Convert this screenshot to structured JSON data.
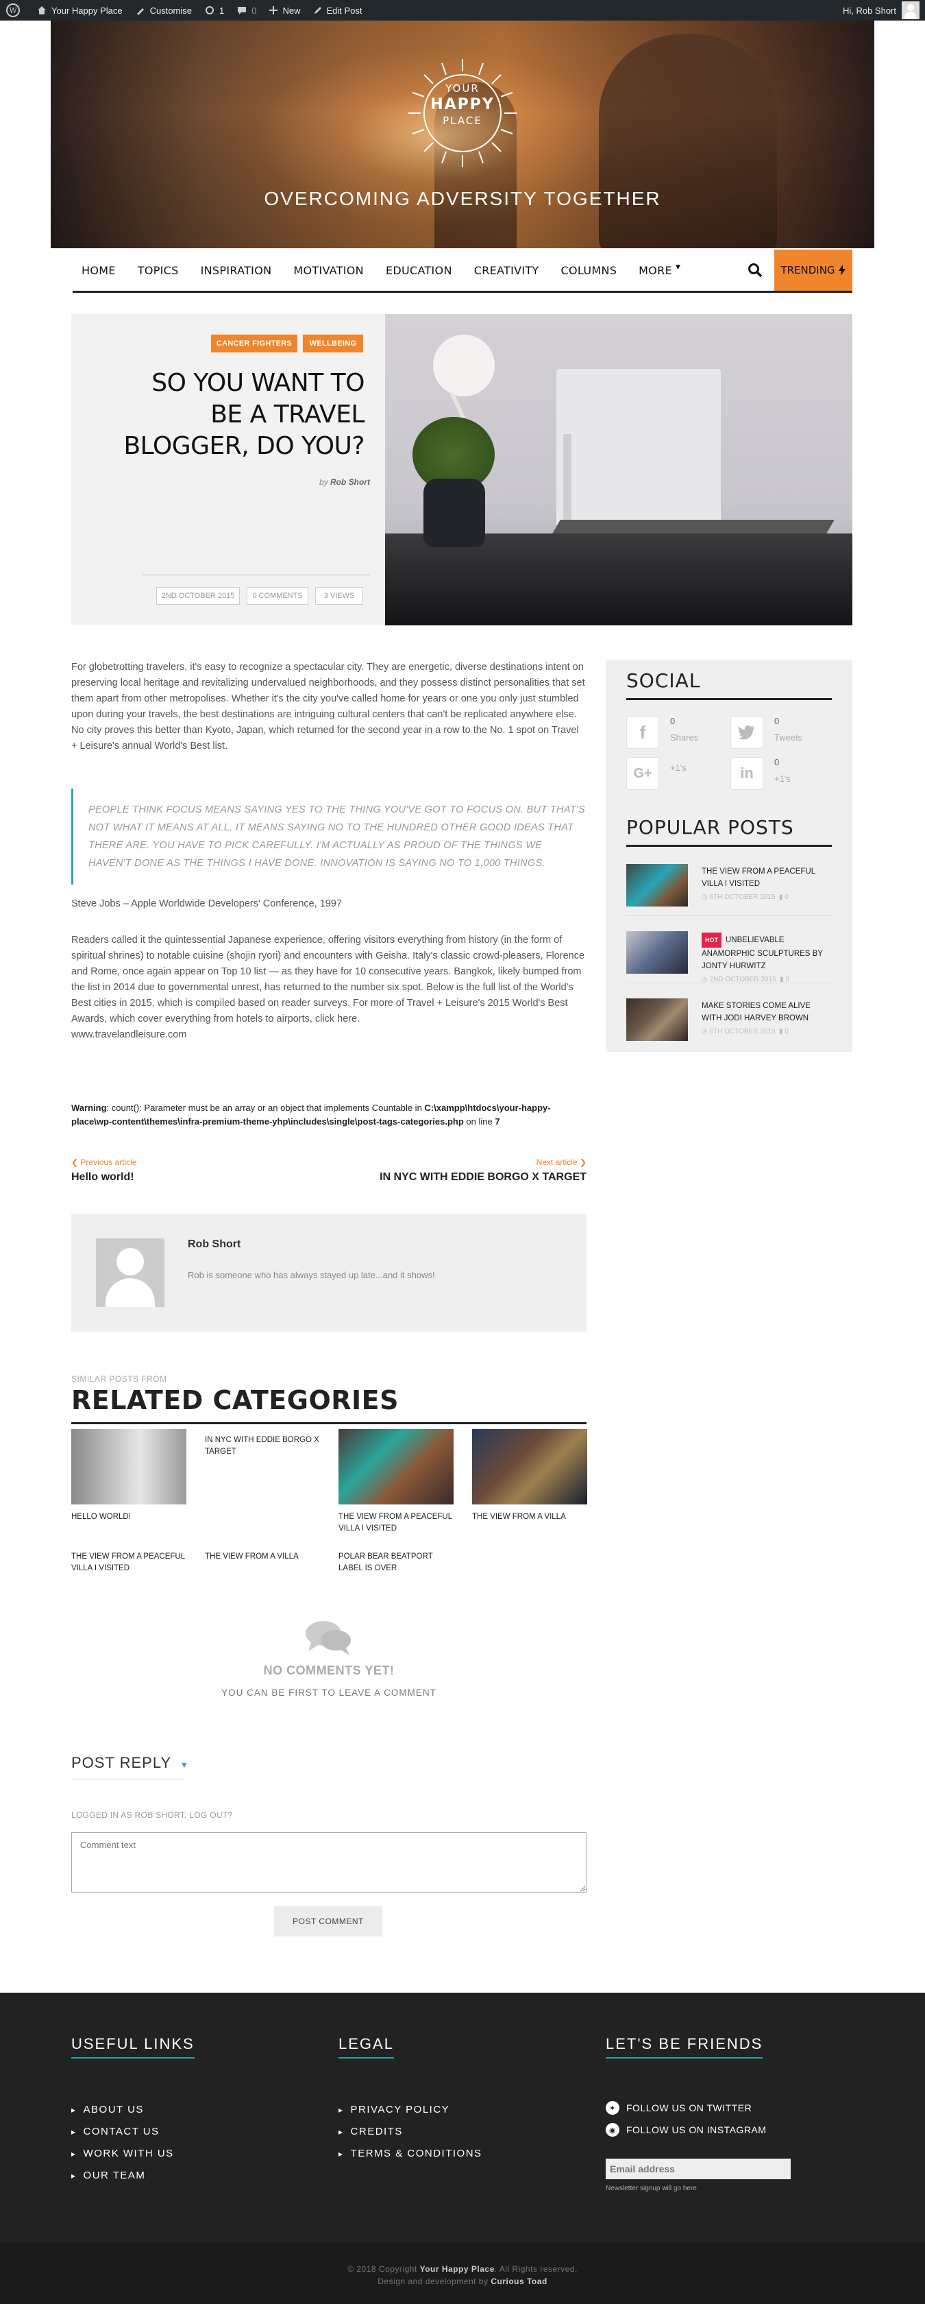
{
  "admin_bar": {
    "site": "Your Happy Place",
    "customise": "Customise",
    "updates": "1",
    "comments": "0",
    "new": "New",
    "edit": "Edit Post",
    "greeting": "Hi, Rob Short"
  },
  "header": {
    "logo_line1": "YOUR",
    "logo_line2": "HAPPY",
    "logo_line3": "PLACE",
    "tagline": "OVERCOMING ADVERSITY TOGETHER"
  },
  "nav": {
    "items": [
      "HOME",
      "TOPICS",
      "INSPIRATION",
      "MOTIVATION",
      "EDUCATION",
      "CREATIVITY",
      "COLUMNS",
      "MORE"
    ],
    "trending": "TRENDING"
  },
  "post": {
    "tags": [
      "CANCER FIGHTERS",
      "WELLBEING"
    ],
    "title": "SO YOU WANT TO BE A TRAVEL BLOGGER, DO YOU?",
    "by": "by",
    "author": "Rob Short",
    "date": "2ND OCTOBER 2015",
    "comments": "0 COMMENTS",
    "views": "3 VIEWS",
    "paragraph1": "For globetrotting travelers, it's easy to recognize a spectacular city. They are energetic, diverse destinations intent on preserving local heritage and revitalizing undervalued neighborhoods, and they possess distinct personalities that set them apart from other metropolises. Whether it's the city you've called home for years or one you only just stumbled upon during your travels, the best destinations are intriguing cultural centers that can't be replicated anywhere else. No city proves this better than Kyoto, Japan, which returned for the second year in a row to the No. 1 spot on Travel + Leisure's annual World's Best list.",
    "quote": "PEOPLE THINK FOCUS MEANS SAYING YES TO THE THING YOU'VE GOT TO FOCUS ON. BUT THAT'S NOT WHAT IT MEANS AT ALL. IT MEANS SAYING NO TO THE HUNDRED OTHER GOOD IDEAS THAT THERE ARE. YOU HAVE TO PICK CAREFULLY. I'M ACTUALLY AS PROUD OF THE THINGS WE HAVEN'T DONE AS THE THINGS I HAVE DONE. INNOVATION IS SAYING NO TO 1,000 THINGS.",
    "quote_source": "Steve Jobs – Apple Worldwide Developers' Conference, 1997",
    "paragraph2": "Readers called it the quintessential Japanese experience, offering visitors everything from history (in the form of spiritual shrines) to notable cuisine (shojin ryori) and encounters with Geisha. Italy's classic crowd-pleasers, Florence and Rome, once again appear on Top 10 list — as they have for 10 consecutive years. Bangkok, likely bumped from the list in 2014 due to governmental unrest, has returned to the number six spot. Below is the full list of the World's Best cities in 2015, which is compiled based on reader surveys. For more of Travel + Leisure's 2015 World's Best Awards, which cover everything from hotels to airports, click here.",
    "source_link": "www.travelandleisure.com"
  },
  "warning": {
    "label": "Warning",
    "text1": ": count(): Parameter must be an array or an object that implements Countable in ",
    "path": "C:\\xampp\\htdocs\\your-happy-place\\wp-content\\themes\\infra-premium-theme-yhp\\includes\\single\\post-tags-categories.php",
    "text2": " on line ",
    "line": "7"
  },
  "prev_next": {
    "prev_label": "Previous article",
    "prev_title": "Hello world!",
    "next_label": "Next article",
    "next_title": "IN NYC WITH EDDIE BORGO X TARGET"
  },
  "author_box": {
    "name": "Rob Short",
    "bio": "Rob is someone who has always stayed up late...and it shows!"
  },
  "sidebar": {
    "social_title": "SOCIAL",
    "social": [
      {
        "icon": "facebook-icon",
        "count": "0",
        "label": "Shares"
      },
      {
        "icon": "twitter-icon",
        "count": "0",
        "label": "Tweets"
      },
      {
        "icon": "google-plus-icon",
        "count": "",
        "label": "+1's"
      },
      {
        "icon": "linkedin-icon",
        "count": "0",
        "label": "+1's"
      }
    ],
    "popular_title": "POPULAR POSTS",
    "popular": [
      {
        "badge": "",
        "title": "THE VIEW FROM A PEACEFUL VILLA I VISITED",
        "date": "6TH OCTOBER 2015",
        "comments": "0"
      },
      {
        "badge": "HOT",
        "title": "UNBELIEVABLE ANAMORPHIC SCULPTURES BY JONTY HURWITZ",
        "date": "2ND OCTOBER 2015",
        "comments": "0"
      },
      {
        "badge": "",
        "title": "MAKE STORIES COME ALIVE WITH JODI HARVEY BROWN",
        "date": "6TH OCTOBER 2015",
        "comments": "0"
      }
    ]
  },
  "related": {
    "kicker": "SIMILAR POSTS FROM",
    "title": "RELATED CATEGORIES",
    "items": [
      {
        "title": "HELLO WORLD!"
      },
      {
        "title": "IN NYC WITH EDDIE BORGO X TARGET"
      },
      {
        "title": "THE VIEW FROM A PEACEFUL VILLA I VISITED"
      },
      {
        "title": "THE VIEW FROM A VILLA"
      },
      {
        "title": "THE VIEW FROM A PEACEFUL VILLA I VISITED"
      },
      {
        "title": "THE VIEW FROM A VILLA"
      },
      {
        "title": "POLAR BEAR BEATPORT LABEL IS OVER"
      }
    ]
  },
  "comments": {
    "none": "NO COMMENTS YET!",
    "first": "YOU CAN BE FIRST TO LEAVE A COMMENT",
    "post_reply": "POST REPLY",
    "logged_in": "LOGGED IN AS ROB SHORT. LOG OUT?",
    "placeholder": "Comment text",
    "submit": "POST COMMENT"
  },
  "footer": {
    "useful_title": "USEFUL LINKS",
    "useful": [
      "ABOUT US",
      "CONTACT US",
      "WORK WITH US",
      "OUR TEAM"
    ],
    "legal_title": "LEGAL",
    "legal": [
      "PRIVACY POLICY",
      "CREDITS",
      "TERMS & CONDITIONS"
    ],
    "friends_title": "LET'S BE FRIENDS",
    "twitter": "FOLLOW US ON TWITTER",
    "instagram": "FOLLOW US ON INSTAGRAM",
    "email_placeholder": "Email address",
    "newsletter_note": "Newsletter signup will go here",
    "copyright_pre": "© 2018 Copyright ",
    "copyright_site": "Your Happy Place",
    "copyright_post": ". All Rights reserved.",
    "credit_pre": "Design and development by ",
    "credit_name": "Curious Toad"
  },
  "colors": {
    "accent": "#f0852c",
    "teal": "#2aa5b6",
    "hot": "#e52249",
    "footer_bg": "#222222"
  }
}
